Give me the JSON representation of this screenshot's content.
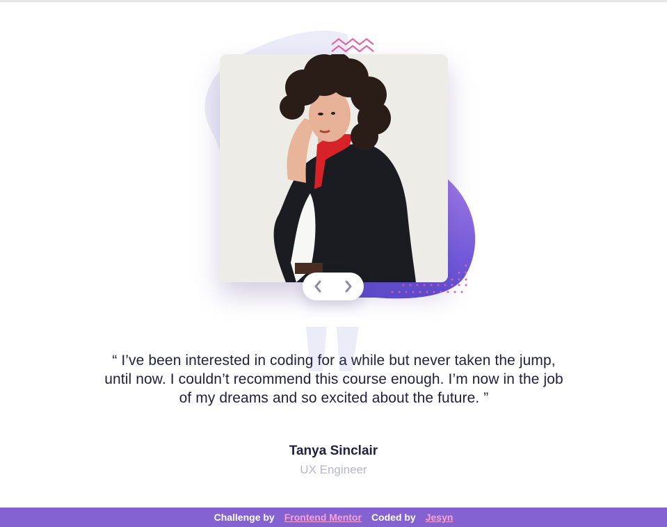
{
  "testimonial": {
    "quote": "“ I’ve been interested in coding for a while but never taken the jump, until now. I couldn’t recommend this course enough. I’m now in the job of my dreams and so excited about the future. ”",
    "author": "Tanya Sinclair",
    "role": "UX Engineer"
  },
  "nav": {
    "prev_icon": "chevron-left-icon",
    "next_icon": "chevron-right-icon"
  },
  "footer": {
    "challenge_label": "Challenge by",
    "challenge_link": "Frontend Mentor",
    "coded_label": "Coded by",
    "coded_link": "Jesyn"
  },
  "colors": {
    "text": "#202140",
    "muted": "#b6b5cc",
    "accent": "#8463d1",
    "link": "#ff9fd2",
    "blob_light": "#ececf8",
    "blob_purple": "#7e5fe0"
  }
}
